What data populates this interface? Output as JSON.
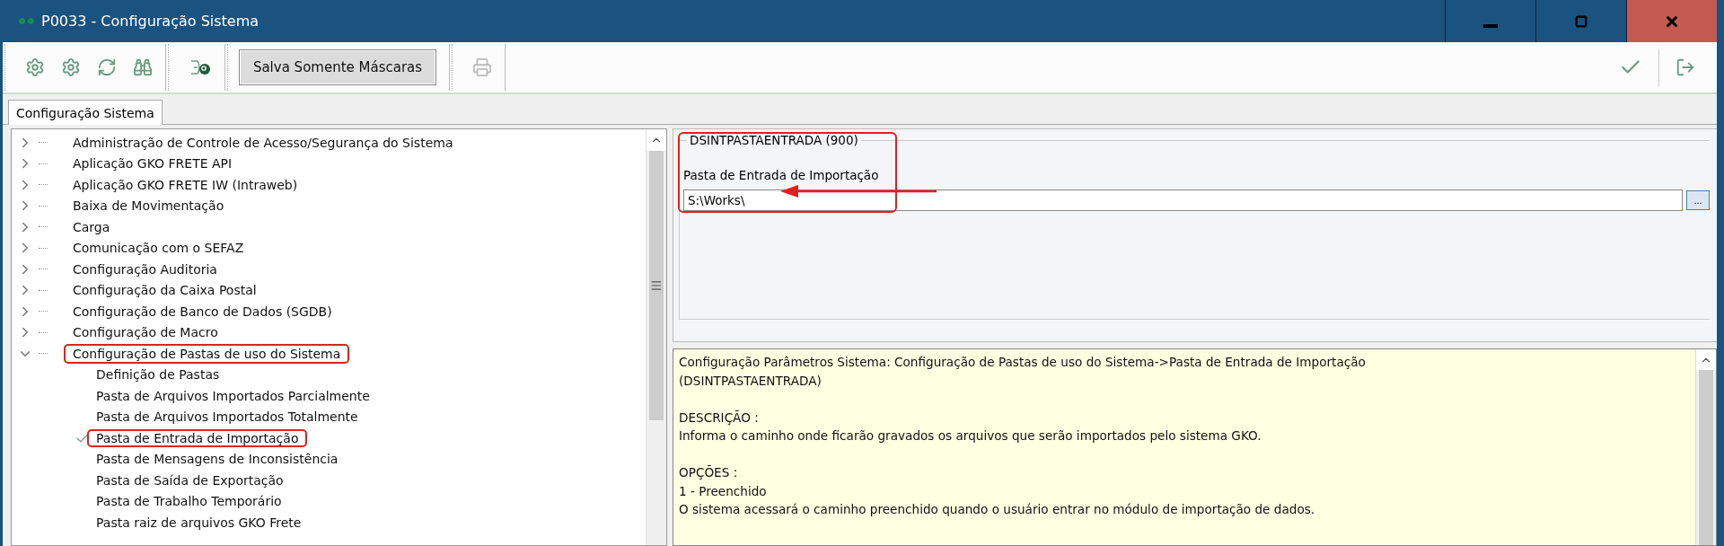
{
  "window": {
    "title": "P0033 - Configuração Sistema"
  },
  "toolbar": {
    "save_masks_button": "Salva Somente Máscaras"
  },
  "tabs": [
    {
      "label": "Configuração Sistema",
      "selected": true
    }
  ],
  "tree": {
    "items": [
      {
        "label": "Administração de Controle de Acesso/Segurança do Sistema",
        "expanded": false,
        "annotated": false
      },
      {
        "label": "Aplicação GKO FRETE API",
        "expanded": false,
        "annotated": false
      },
      {
        "label": "Aplicação GKO FRETE IW (Intraweb)",
        "expanded": false,
        "annotated": false
      },
      {
        "label": "Baixa de Movimentação",
        "expanded": false,
        "annotated": false
      },
      {
        "label": "Carga",
        "expanded": false,
        "annotated": false
      },
      {
        "label": "Comunicação com o SEFAZ",
        "expanded": false,
        "annotated": false
      },
      {
        "label": "Configuração Auditoria",
        "expanded": false,
        "annotated": false
      },
      {
        "label": "Configuração da Caixa Postal",
        "expanded": false,
        "annotated": false
      },
      {
        "label": "Configuração de Banco de Dados (SGDB)",
        "expanded": false,
        "annotated": false
      },
      {
        "label": "Configuração de Macro",
        "expanded": false,
        "annotated": false
      },
      {
        "label": "Configuração de Pastas de uso do Sistema",
        "expanded": true,
        "annotated": true,
        "children": [
          {
            "label": "Definição de Pastas",
            "selected": false,
            "annotated": false
          },
          {
            "label": "Pasta de Arquivos Importados Parcialmente",
            "selected": false,
            "annotated": false
          },
          {
            "label": "Pasta de Arquivos Importados Totalmente",
            "selected": false,
            "annotated": false
          },
          {
            "label": "Pasta de Entrada de Importação",
            "selected": true,
            "annotated": true
          },
          {
            "label": "Pasta de Mensagens de Inconsistência",
            "selected": false,
            "annotated": false
          },
          {
            "label": "Pasta de Saída de Exportação",
            "selected": false,
            "annotated": false
          },
          {
            "label": "Pasta de Trabalho Temporário",
            "selected": false,
            "annotated": false
          },
          {
            "label": "Pasta raiz de arquivos GKO Frete",
            "selected": false,
            "annotated": false
          }
        ]
      }
    ]
  },
  "parameter": {
    "group_title": "DSINTPASTAENTRADA (900)",
    "label": "Pasta de Entrada de Importação",
    "value": "S:\\Works\\",
    "browse_button": "...",
    "annotated": true
  },
  "help": {
    "paragraphs": [
      [
        "Configuração Parâmetros Sistema: Configuração de Pastas de uso do Sistema->Pasta de Entrada de Importação",
        "(DSINTPASTAENTRADA)"
      ],
      [
        "DESCRIÇÃO :",
        "Informa o caminho onde ficarão gravados os arquivos que serão importados pelo sistema GKO."
      ],
      [
        "OPÇÕES :",
        "1 - Preenchido",
        "O sistema acessará o caminho preenchido quando o usuário entrar no módulo de importação de dados."
      ]
    ]
  }
}
